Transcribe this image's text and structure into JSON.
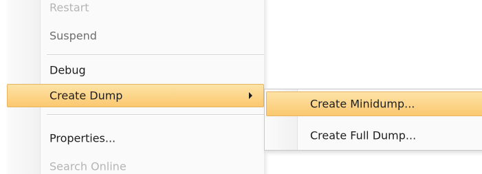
{
  "context_menu": {
    "items": [
      {
        "label": "Restart"
      },
      {
        "label": "Suspend"
      },
      {
        "label": "Debug"
      },
      {
        "label": "Create Dump",
        "has_submenu": true,
        "highlighted": true
      },
      {
        "label": "Properties..."
      },
      {
        "label": "Search Online"
      }
    ]
  },
  "submenu": {
    "items": [
      {
        "label": "Create Minidump...",
        "highlighted": true
      },
      {
        "label": "Create Full Dump..."
      }
    ]
  },
  "colors": {
    "highlight_top": "#fde3a6",
    "highlight_bottom": "#fbc870",
    "highlight_border": "#e7b35f",
    "menu_background": "#fafafa"
  }
}
